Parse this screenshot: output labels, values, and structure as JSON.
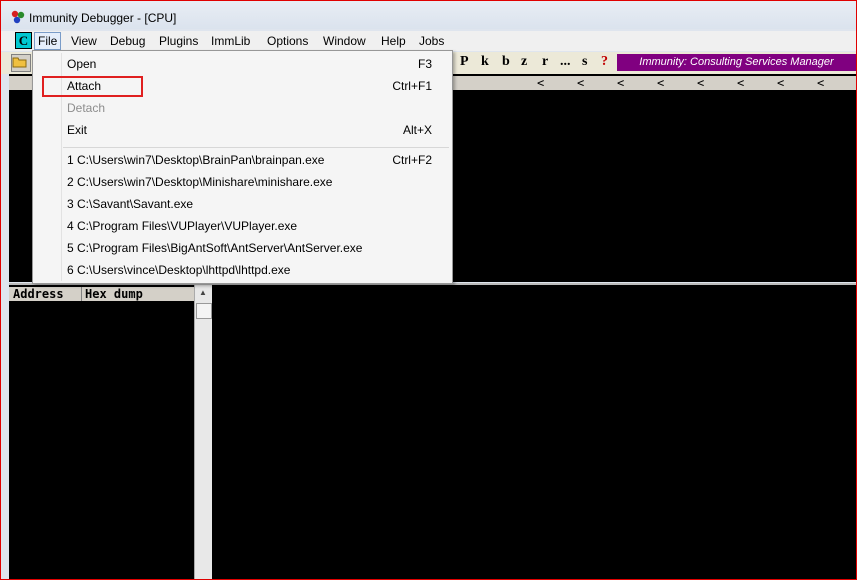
{
  "window": {
    "title": "Immunity Debugger - [CPU]"
  },
  "menubar": {
    "c_button": "C",
    "items": [
      "File",
      "View",
      "Debug",
      "Plugins",
      "ImmLib",
      "Options",
      "Window",
      "Help",
      "Jobs"
    ]
  },
  "toolbar": {
    "letters": [
      "P",
      "k",
      "b",
      "z",
      "r",
      "...",
      "s",
      "?"
    ],
    "consulting": "Immunity: Consulting Services Manager"
  },
  "cpu_header": {
    "chevrons": [
      "<",
      "<",
      "<",
      "<",
      "<",
      "<",
      "<",
      "<"
    ]
  },
  "dump": {
    "col_address": "Address",
    "col_hex": "Hex dump"
  },
  "file_menu": {
    "open": {
      "label": "Open",
      "shortcut": "F3"
    },
    "attach": {
      "label": "Attach",
      "shortcut": "Ctrl+F1"
    },
    "detach": {
      "label": "Detach"
    },
    "exit": {
      "label": "Exit",
      "shortcut": "Alt+X"
    },
    "recent": [
      {
        "label": "1 C:\\Users\\win7\\Desktop\\BrainPan\\brainpan.exe",
        "shortcut": "Ctrl+F2"
      },
      {
        "label": "2 C:\\Users\\win7\\Desktop\\Minishare\\minishare.exe"
      },
      {
        "label": "3 C:\\Savant\\Savant.exe"
      },
      {
        "label": "4 C:\\Program Files\\VUPlayer\\VUPlayer.exe"
      },
      {
        "label": "5 C:\\Program Files\\BigAntSoft\\AntServer\\AntServer.exe"
      },
      {
        "label": "6 C:\\Users\\vince\\Desktop\\lhttpd\\lhttpd.exe"
      }
    ]
  },
  "colors": {
    "accent_purple": "#800080",
    "highlight_red": "#e02020",
    "c_button": "#00c8d0"
  }
}
